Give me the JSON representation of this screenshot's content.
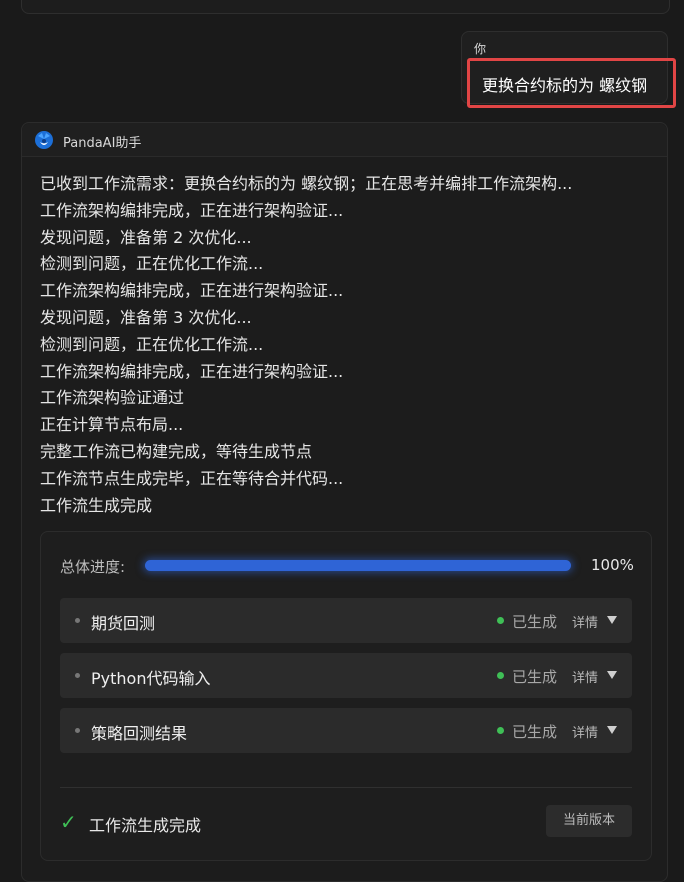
{
  "user_message": {
    "author": "你",
    "text": "更换合约标的为 螺纹钢"
  },
  "assistant": {
    "name": "PandaAI助手",
    "log_lines": [
      "已收到工作流需求：更换合约标的为 螺纹钢；正在思考并编排工作流架构...",
      "工作流架构编排完成，正在进行架构验证...",
      "发现问题，准备第 2 次优化...",
      "检测到问题，正在优化工作流...",
      "工作流架构编排完成，正在进行架构验证...",
      "发现问题，准备第 3 次优化...",
      "检测到问题，正在优化工作流...",
      "工作流架构编排完成，正在进行架构验证...",
      "工作流架构验证通过",
      "正在计算节点布局...",
      "完整工作流已构建完成，等待生成节点",
      "工作流节点生成完毕，正在等待合并代码...",
      "工作流生成完成"
    ]
  },
  "progress": {
    "label": "总体进度:",
    "value": 1.0,
    "percent_text": "100%"
  },
  "steps": [
    {
      "name": "期货回测",
      "status": "已生成",
      "detail": "详情"
    },
    {
      "name": "Python代码输入",
      "status": "已生成",
      "detail": "详情"
    },
    {
      "name": "策略回测结果",
      "status": "已生成",
      "detail": "详情"
    }
  ],
  "footer": {
    "status_text": "工作流生成完成",
    "version_button": "当前版本"
  },
  "colors": {
    "accent_blue": "#2f64d6",
    "success_green": "#3fbf56",
    "highlight_red": "#e14545"
  }
}
